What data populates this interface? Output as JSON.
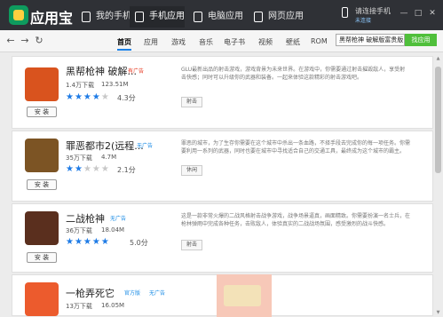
{
  "app": {
    "title": "应用宝"
  },
  "titlebar": {
    "tabs": [
      {
        "label": "我的手机"
      },
      {
        "label": "手机应用"
      },
      {
        "label": "电脑应用"
      },
      {
        "label": "网页应用"
      }
    ],
    "connect_phone": "请连接手机",
    "connect_sub": "未连接"
  },
  "nav": {
    "back": "←",
    "forward": "→",
    "refresh": "↻",
    "categories": [
      "首页",
      "应用",
      "游戏",
      "音乐",
      "电子书",
      "视频",
      "壁纸",
      "ROM"
    ],
    "search": {
      "value": "黑帮枪神 破解版富贵版"
    },
    "search_button": "找应用"
  },
  "apps": [
    {
      "name": "黑帮枪神 破解...",
      "badge": "有广告",
      "downloads": "1.4万下载",
      "size": "123.51M",
      "rating": 4.3,
      "rating_text": "4.3分",
      "install": "安 装",
      "description": "GLU最新出品的射击游戏，游戏背景为未来世界。在游戏中，你需要通过射击摧毁敌人，享受射击快感；同时可以升级你的武器和装备。一起来体验这款精彩的射击游戏吧。",
      "tag": "射击"
    },
    {
      "name": "罪恶都市2(远程...",
      "badge": "无广告",
      "downloads": "35万下载",
      "size": "4.7M",
      "rating": 2.1,
      "rating_text": "2.1分",
      "install": "安 装",
      "description": "罪恶的城市，为了生存你需要在这个城市中杀出一条血路，不择手段去完成你的每一项任务。你需要利用一系列的武器，同时也要在城市中寻找适合自己的交通工具，最终成为这个城市的霸主。",
      "tag": "休闲"
    },
    {
      "name": "二战枪神",
      "badge": "无广告",
      "downloads": "36万下载",
      "size": "18.04M",
      "rating": 5.0,
      "rating_text": "5.0分",
      "install": "安 装",
      "description": "这是一款非常火爆的二战风格射击战争游戏，战争场景逼真，画面精致。你需要扮演一名士兵，在枪林弹雨中完成各种任务，击败敌人，体验真实的二战战场氛围，感受激烈的战斗快感。",
      "tag": "射击"
    },
    {
      "name": "一枪弄死它",
      "badge": "官方版",
      "badge2": "无广告",
      "downloads": "13万下载",
      "size": "16.05M"
    }
  ],
  "colors": {
    "accent": "#1b80e5",
    "green": "#4fbf3b",
    "star": "#1e7be6",
    "ad_red": "#e6331a",
    "noad_blue": "#1a8ce6"
  }
}
